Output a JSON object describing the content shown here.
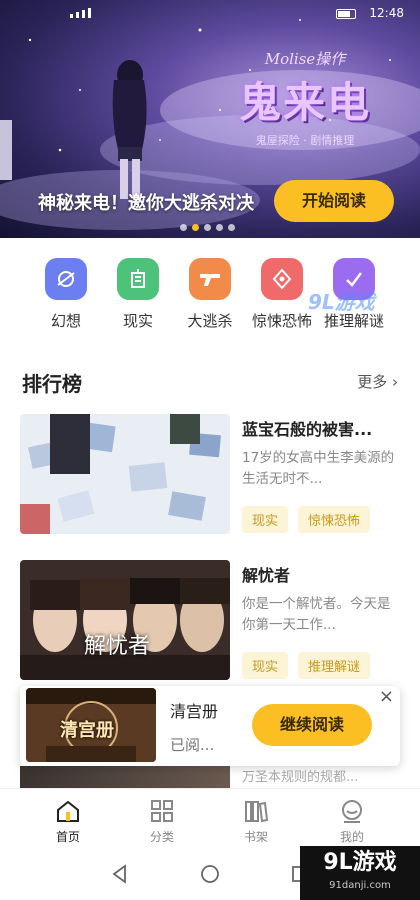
{
  "status_bar": {
    "time": "12:48"
  },
  "banner": {
    "logo_top": "Molise操作",
    "logo_main": "鬼来电",
    "logo_sub": "鬼屋探险 · 剧情推理",
    "title": "神秘来电！邀你大逃杀对决",
    "button": "开始阅读",
    "dots": 5,
    "active_dot": 1
  },
  "categories": [
    {
      "label": "幻想",
      "icon": "planet-icon",
      "color": "#6b7ff0"
    },
    {
      "label": "现实",
      "icon": "building-icon",
      "color": "#4cc27a"
    },
    {
      "label": "大逃杀",
      "icon": "gun-icon",
      "color": "#f28a4a"
    },
    {
      "label": "惊悚恐怖",
      "icon": "mask-icon",
      "color": "#f06a6a"
    },
    {
      "label": "推理解谜",
      "icon": "puzzle-icon",
      "color": "#9b6cf0"
    }
  ],
  "ranking": {
    "title": "排行榜",
    "more": "更多",
    "books": [
      {
        "title": "蓝宝石般的被害...",
        "desc": "17岁的女高中生李美源的生活无时不...",
        "tags": [
          "现实",
          "惊悚恐怖"
        ]
      },
      {
        "title": "解忧者",
        "desc": "你是一个解忧者。今天是你第一天工作...",
        "cover_text": "解忧者",
        "tags": [
          "现实",
          "推理解谜"
        ]
      }
    ],
    "peek_text": "万圣本规则的规都..."
  },
  "continue_card": {
    "book": "清宫册",
    "progress": "已阅...",
    "cover_text": "清宫册",
    "button": "继续阅读",
    "close": "×"
  },
  "bottom_nav": [
    {
      "label": "首页",
      "icon": "home-icon",
      "active": true
    },
    {
      "label": "分类",
      "icon": "category-icon",
      "active": false
    },
    {
      "label": "书架",
      "icon": "bookshelf-icon",
      "active": false
    },
    {
      "label": "我的",
      "icon": "profile-icon",
      "active": false
    }
  ],
  "watermark": {
    "brand": "9L游戏",
    "site": "91danji.com",
    "overlay": "9L游戏"
  },
  "colors": {
    "accent": "#fbbf24",
    "tag_bg": "#fdf3d6",
    "tag_text": "#c79a1e"
  }
}
